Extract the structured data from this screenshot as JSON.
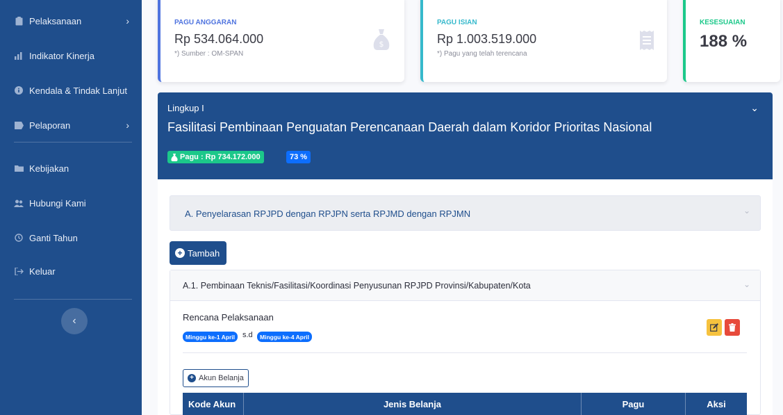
{
  "sidebar": {
    "items": [
      {
        "label": "Pelaksanaan",
        "icon": "clipboard-icon",
        "has_chevron": true
      },
      {
        "label": "Indikator Kinerja",
        "icon": "bar-chart-icon",
        "has_chevron": false
      },
      {
        "label": "Kendala & Tindak Lanjut",
        "icon": "info-circle-icon",
        "has_chevron": false
      },
      {
        "label": "Pelaporan",
        "icon": "report-icon",
        "has_chevron": true
      },
      {
        "label": "Kebijakan",
        "icon": "folder-icon",
        "has_chevron": false
      },
      {
        "label": "Hubungi Kami",
        "icon": "users-icon",
        "has_chevron": false
      },
      {
        "label": "Ganti Tahun",
        "icon": "history-icon",
        "has_chevron": false
      },
      {
        "label": "Keluar",
        "icon": "sign-out-icon",
        "has_chevron": false
      }
    ],
    "chevron": "›",
    "toggle_glyph": "‹"
  },
  "stats": {
    "pagu_anggaran": {
      "label": "PAGU ANGGARAN",
      "value": "Rp 534.064.000",
      "note": "*) Sumber : OM-SPAN",
      "accent": "#4e73df"
    },
    "pagu_isian": {
      "label": "PAGU ISIAN",
      "value": "Rp 1.003.519.000",
      "note": "*) Pagu yang telah terencana",
      "accent": "#36b9cc"
    },
    "kesesuaian": {
      "label": "KESESUAIAN",
      "value": "188 %",
      "accent": "#1cc88a"
    }
  },
  "lingkup": {
    "small": "Lingkup I",
    "title": "Fasilitasi Pembinaan Penguatan Perencanaan Daerah dalam Koridor Prioritas Nasional",
    "pagu_badge": "Pagu : Rp 734.172.000",
    "percent_badge": "73 %",
    "chevron": "⌄"
  },
  "section_a": {
    "title": "A.  Penyelarasan RPJPD dengan RPJPN serta RPJMD dengan RPJMN",
    "chevron": "⌄"
  },
  "tambah_button": "Tambah",
  "section_a1": {
    "title": "A.1. Pembinaan Teknis/Fasilitasi/Koordinasi Penyusunan RPJPD Provinsi/Kabupaten/Kota",
    "chevron": "⌄",
    "rencana_label": "Rencana Pelaksanaan",
    "start_badge": "Minggu ke-1 April",
    "sd_text": "s.d",
    "end_badge": "Minggu ke-4 April",
    "akun_button": "Akun Belanja",
    "table_headers": [
      "Kode Akun",
      "Jenis Belanja",
      "Pagu",
      "Aksi"
    ]
  },
  "colors": {
    "primary": "#1f4e8c",
    "success": "#1cc88a",
    "info": "#0d6efd",
    "warning": "#f6c23e",
    "danger": "#e74a3b"
  }
}
